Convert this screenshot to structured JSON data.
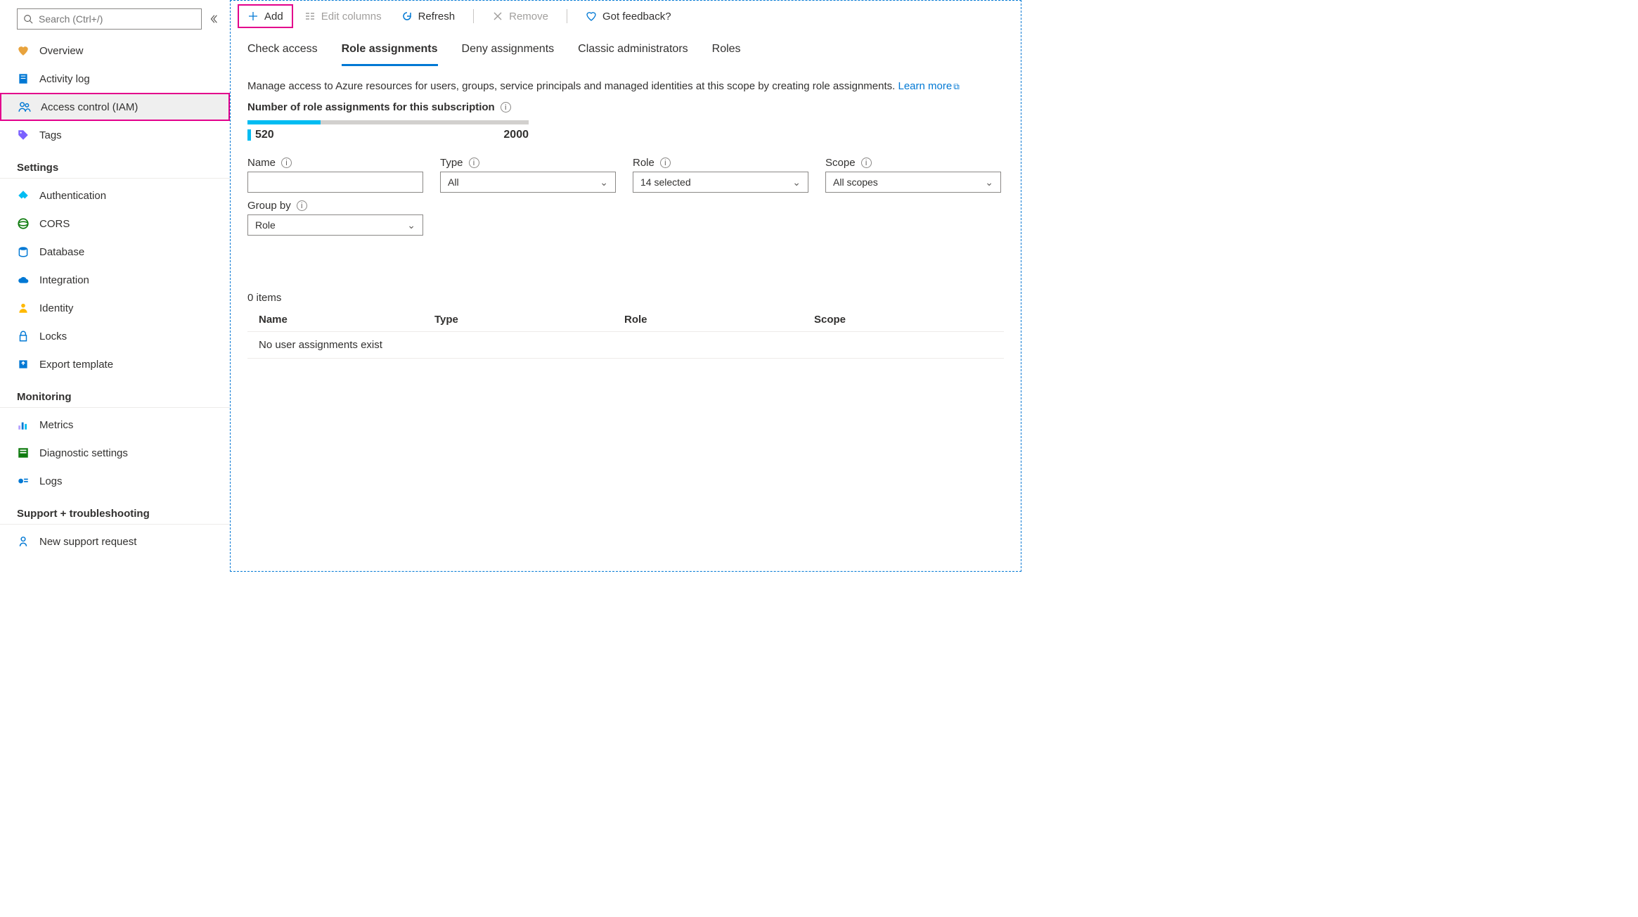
{
  "sidebar": {
    "search_placeholder": "Search (Ctrl+/)",
    "items": [
      {
        "icon": "heart",
        "color": "#e8a33d",
        "label": "Overview"
      },
      {
        "icon": "log",
        "color": "#0078d4",
        "label": "Activity log"
      },
      {
        "icon": "people",
        "color": "#0078d4",
        "label": "Access control (IAM)",
        "selected": true,
        "highlight": true
      },
      {
        "icon": "tag",
        "color": "#7b61ff",
        "label": "Tags"
      }
    ],
    "sections": [
      {
        "title": "Settings",
        "items": [
          {
            "icon": "key",
            "color": "#00bcf2",
            "label": "Authentication"
          },
          {
            "icon": "cors",
            "color": "#107c10",
            "label": "CORS"
          },
          {
            "icon": "db",
            "color": "#0078d4",
            "label": "Database"
          },
          {
            "icon": "cloud",
            "color": "#0078d4",
            "label": "Integration"
          },
          {
            "icon": "id",
            "color": "#ffb900",
            "label": "Identity"
          },
          {
            "icon": "lock",
            "color": "#0078d4",
            "label": "Locks"
          },
          {
            "icon": "export",
            "color": "#0078d4",
            "label": "Export template"
          }
        ]
      },
      {
        "title": "Monitoring",
        "items": [
          {
            "icon": "metrics",
            "color": "#0078d4",
            "label": "Metrics"
          },
          {
            "icon": "diag",
            "color": "#107c10",
            "label": "Diagnostic settings"
          },
          {
            "icon": "logs",
            "color": "#0078d4",
            "label": "Logs"
          }
        ]
      },
      {
        "title": "Support + troubleshooting",
        "items": [
          {
            "icon": "support",
            "color": "#0078d4",
            "label": "New support request"
          }
        ]
      }
    ]
  },
  "toolbar": {
    "add": "Add",
    "edit_columns": "Edit columns",
    "refresh": "Refresh",
    "remove": "Remove",
    "feedback": "Got feedback?"
  },
  "tabs": [
    "Check access",
    "Role assignments",
    "Deny assignments",
    "Classic administrators",
    "Roles"
  ],
  "active_tab": 1,
  "description": "Manage access to Azure resources for users, groups, service principals and managed identities at this scope by creating role assignments. ",
  "learn_more": "Learn more",
  "count_label": "Number of role assignments for this subscription",
  "count_current": "520",
  "count_max": "2000",
  "filters": {
    "name_label": "Name",
    "name_value": "",
    "type_label": "Type",
    "type_value": "All",
    "role_label": "Role",
    "role_value": "14 selected",
    "scope_label": "Scope",
    "scope_value": "All scopes",
    "groupby_label": "Group by",
    "groupby_value": "Role"
  },
  "table": {
    "items_count": "0 items",
    "columns": [
      "Name",
      "Type",
      "Role",
      "Scope"
    ],
    "empty": "No user assignments exist"
  }
}
